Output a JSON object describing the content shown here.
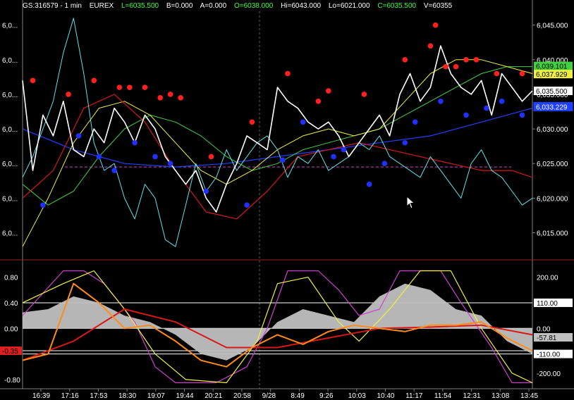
{
  "header": {
    "symbol": "GS:316579 - 1 min",
    "exchange": "EUREX",
    "last": "L=6035.500",
    "bid": "B=0.000",
    "ask": "A=0.000",
    "open": "O=6038.000",
    "high": "Hi=6043.000",
    "low": "Lo=6021.000",
    "close": "C=6035.500",
    "volume": "V=60355"
  },
  "colors": {
    "background": "#000000",
    "price": "#ffffff",
    "cyan": "#5fe0e8",
    "red": "#d81818",
    "yellow": "#f0f040",
    "green": "#40d040",
    "blue": "#2040ff",
    "magenta": "#d040d0",
    "orange": "#ff8c1a",
    "gray_fill": "#c0c0c0",
    "grid": "#404040"
  },
  "chart_data": [
    {
      "type": "line",
      "panel": "price",
      "ylim": [
        6012,
        6047
      ],
      "right_ticks": [
        "6,045.000",
        "6,040.000",
        "6,035.000",
        "6,030.000",
        "6,025.000",
        "6,020.000",
        "6,015.000"
      ],
      "right_tick_values": [
        6045,
        6040,
        6035,
        6030,
        6025,
        6020,
        6015
      ],
      "left_ticks": [
        "6,0...",
        "6,0...",
        "6,0...",
        "6,0...",
        "6,0...",
        "6,0...",
        "6,0..."
      ],
      "value_tags": [
        {
          "label": "6,039.101",
          "value": 6039.101,
          "color": "#40d040",
          "text_color": "#000000"
        },
        {
          "label": "6,037.929",
          "value": 6037.929,
          "color": "#f0f040",
          "text_color": "#000000"
        },
        {
          "label": "6,035.500",
          "value": 6035.5,
          "color": "#ffffff",
          "text_color": "#000000"
        },
        {
          "label": "6,033.229",
          "value": 6033.229,
          "color": "#2040ff",
          "text_color": "#2040ff"
        }
      ],
      "dashed_level": 6024.5,
      "series": [
        {
          "color": "white",
          "x": [
            0,
            2,
            4,
            6,
            8,
            10,
            12,
            14,
            16,
            18,
            20,
            22,
            24,
            26,
            28,
            30,
            32,
            34,
            36,
            38,
            40,
            42,
            44,
            46,
            48,
            50,
            52,
            54,
            56,
            58,
            60,
            62,
            64,
            66,
            68,
            70,
            72,
            74,
            76,
            78,
            80,
            82,
            84,
            86,
            88,
            90,
            92,
            94,
            96,
            98,
            100
          ],
          "y": [
            6037,
            6024,
            6032,
            6029,
            6034,
            6027,
            6026,
            6030,
            6028,
            6033,
            6031,
            6028,
            6032,
            6030,
            6026,
            6024,
            6022,
            6024,
            6020,
            6018,
            6022,
            6025,
            6029,
            6028,
            6027,
            6036,
            6034,
            6033,
            6031,
            6030,
            6031,
            6029,
            6026,
            6028,
            6030,
            6032,
            6029,
            6035,
            6038,
            6034,
            6036,
            6042,
            6038,
            6036,
            6035,
            6037,
            6032,
            6038,
            6036,
            6034,
            6035.5
          ]
        },
        {
          "color": "cyan",
          "x": [
            0,
            2,
            4,
            6,
            8,
            10,
            12,
            14,
            16,
            18,
            20,
            22,
            24,
            26,
            28,
            30,
            32,
            34,
            36,
            38,
            40,
            42,
            44,
            46,
            48,
            50,
            52,
            54,
            56,
            58,
            60,
            62,
            64,
            66,
            68,
            70,
            72,
            74,
            76,
            78,
            80,
            82,
            84,
            86,
            88,
            90,
            92,
            94,
            96,
            98,
            100
          ],
          "y": [
            6023,
            6026,
            6030,
            6034,
            6041,
            6046,
            6038,
            6028,
            6024,
            6025,
            6020,
            6017,
            6022,
            6020,
            6014,
            6013,
            6019,
            6025,
            6021,
            6023,
            6027,
            6024,
            6026,
            6028,
            6029,
            6027,
            6023,
            6026,
            6025,
            6027,
            6024,
            6025,
            6026,
            6028,
            6027,
            6029,
            6026,
            6025,
            6024,
            6023,
            6026,
            6024,
            6022,
            6020,
            6025,
            6027,
            6024,
            6023,
            6021,
            6019,
            6020
          ]
        },
        {
          "color": "red",
          "x": [
            0,
            6,
            12,
            18,
            24,
            30,
            36,
            42,
            48,
            54,
            60,
            66,
            72,
            78,
            84,
            90,
            96,
            100
          ],
          "y": [
            6020,
            6024,
            6033,
            6035,
            6031,
            6024,
            6018,
            6017,
            6021,
            6026,
            6027,
            6028,
            6027,
            6026,
            6025,
            6024,
            6024,
            6023
          ]
        },
        {
          "color": "yellow",
          "x": [
            0,
            5,
            10,
            15,
            20,
            25,
            30,
            35,
            40,
            45,
            50,
            55,
            60,
            65,
            70,
            75,
            80,
            85,
            90,
            95,
            100
          ],
          "y": [
            6013,
            6020,
            6028,
            6033,
            6034,
            6032,
            6028,
            6024,
            6022,
            6024,
            6027,
            6029,
            6030,
            6029,
            6030,
            6034,
            6038,
            6040,
            6040,
            6039,
            6038
          ]
        },
        {
          "color": "green",
          "x": [
            0,
            5,
            10,
            15,
            20,
            25,
            30,
            35,
            40,
            45,
            50,
            55,
            60,
            65,
            70,
            75,
            80,
            85,
            90,
            95,
            100
          ],
          "y": [
            6022,
            6019,
            6021,
            6026,
            6030,
            6032,
            6031,
            6029,
            6026,
            6024,
            6025,
            6027,
            6028,
            6029,
            6030,
            6032,
            6034,
            6036,
            6038,
            6039,
            6039
          ]
        },
        {
          "color": "blue",
          "x": [
            0,
            10,
            20,
            30,
            40,
            50,
            60,
            70,
            80,
            90,
            100
          ],
          "y": [
            6030,
            6027,
            6025,
            6024.5,
            6025,
            6026,
            6027,
            6028,
            6029,
            6031,
            6033
          ]
        }
      ],
      "red_dots": {
        "x": [
          2,
          9,
          14,
          19,
          21,
          24,
          27,
          29,
          31,
          37,
          45,
          52,
          58,
          60,
          67,
          75,
          80,
          81,
          83,
          85,
          87,
          89,
          93,
          98
        ],
        "y": [
          6037,
          6035,
          6037,
          6036,
          6036,
          6036,
          6034.5,
          6035,
          6034.5,
          6026,
          6031,
          6038,
          6034,
          6035.5,
          6035,
          6040,
          6042,
          6045,
          6039,
          6039,
          6040,
          6040,
          6038,
          6038
        ]
      },
      "blue_dots": {
        "x": [
          4,
          11,
          15,
          18,
          22,
          26,
          29,
          36,
          44,
          51,
          55,
          61,
          63,
          68,
          71,
          75,
          77,
          82,
          87,
          91,
          94,
          98
        ],
        "y": [
          6019,
          6029,
          6026,
          6024,
          6028,
          6026,
          6025,
          6021,
          6019,
          6025.5,
          6031,
          6026,
          6027,
          6022,
          6025,
          6028,
          6031,
          6034,
          6032,
          6033,
          6034,
          6032
        ]
      }
    },
    {
      "type": "line",
      "panel": "oscillator",
      "ylim": [
        -0.9,
        0.95
      ],
      "left_ticks": [
        "0.80",
        "0.40",
        "0.00",
        "-0.35",
        "-0.80"
      ],
      "left_tick_values": [
        0.8,
        0.4,
        0.0,
        -0.35,
        -0.8
      ],
      "right_ticks": [
        "200.00",
        "110.00",
        "0.00",
        "-57.81",
        "-110.00",
        "-200.00"
      ],
      "right_tick_values": [
        0.8,
        0.4,
        0.0,
        -0.14,
        -0.4,
        -0.7
      ],
      "hlines": [
        0.4,
        0.0,
        -0.35,
        -0.4
      ],
      "series": [
        {
          "color": "gray_fill",
          "x": [
            0,
            5,
            10,
            15,
            20,
            25,
            30,
            35,
            40,
            45,
            50,
            55,
            60,
            65,
            70,
            75,
            80,
            85,
            90,
            95,
            100
          ],
          "y": [
            0.25,
            0.3,
            0.5,
            0.4,
            0.2,
            0.1,
            -0.1,
            -0.4,
            -0.5,
            -0.3,
            0.1,
            0.3,
            0.2,
            0.1,
            0.5,
            0.7,
            0.6,
            0.3,
            0.2,
            -0.2,
            -0.4
          ]
        },
        {
          "color": "orange",
          "x": [
            0,
            5,
            10,
            15,
            20,
            25,
            30,
            35,
            40,
            45,
            50,
            55,
            60,
            65,
            70,
            75,
            80,
            85,
            90,
            95,
            100
          ],
          "y": [
            -0.5,
            -0.4,
            0.7,
            0.4,
            0.0,
            0.05,
            -0.2,
            -0.5,
            -0.6,
            -0.3,
            -0.1,
            -0.25,
            -0.05,
            0.05,
            0.0,
            -0.05,
            0.05,
            0.05,
            0.1,
            -0.15,
            -0.35
          ]
        },
        {
          "color": "red",
          "x": [
            0,
            10,
            20,
            30,
            40,
            50,
            60,
            70,
            80,
            90,
            100
          ],
          "y": [
            -0.5,
            -0.2,
            0.3,
            0.1,
            -0.3,
            -0.3,
            -0.15,
            0.0,
            0.02,
            0.05,
            -0.1
          ]
        },
        {
          "color": "magenta",
          "x": [
            0,
            8,
            12,
            16,
            22,
            26,
            30,
            38,
            44,
            48,
            52,
            58,
            62,
            66,
            70,
            74,
            78,
            82,
            86,
            92,
            96,
            100
          ],
          "y": [
            0.2,
            0.9,
            0.9,
            0.7,
            0.1,
            -0.6,
            -0.85,
            -0.85,
            -0.6,
            0.0,
            0.9,
            0.9,
            0.6,
            0.2,
            0.3,
            0.9,
            0.9,
            0.9,
            0.4,
            -0.3,
            -0.85,
            -0.85
          ]
        },
        {
          "color": "yellow",
          "x": [
            0,
            8,
            14,
            20,
            26,
            32,
            40,
            46,
            50,
            56,
            62,
            66,
            72,
            78,
            84,
            90,
            96,
            100
          ],
          "y": [
            0.4,
            0.7,
            0.9,
            0.3,
            -0.4,
            -0.8,
            -0.85,
            -0.2,
            0.7,
            0.8,
            0.1,
            -0.2,
            0.3,
            0.9,
            0.9,
            0.0,
            -0.7,
            -0.85
          ]
        }
      ]
    }
  ],
  "x_axis": {
    "labels": [
      "16:39",
      "17:16",
      "17:53",
      "18:30",
      "19:07",
      "19:44",
      "20:21",
      "20:58",
      "9/28",
      "8:49",
      "9:26",
      "10:03",
      "10:40",
      "11:17",
      "11:54",
      "12:31",
      "13:08",
      "13:45"
    ]
  }
}
